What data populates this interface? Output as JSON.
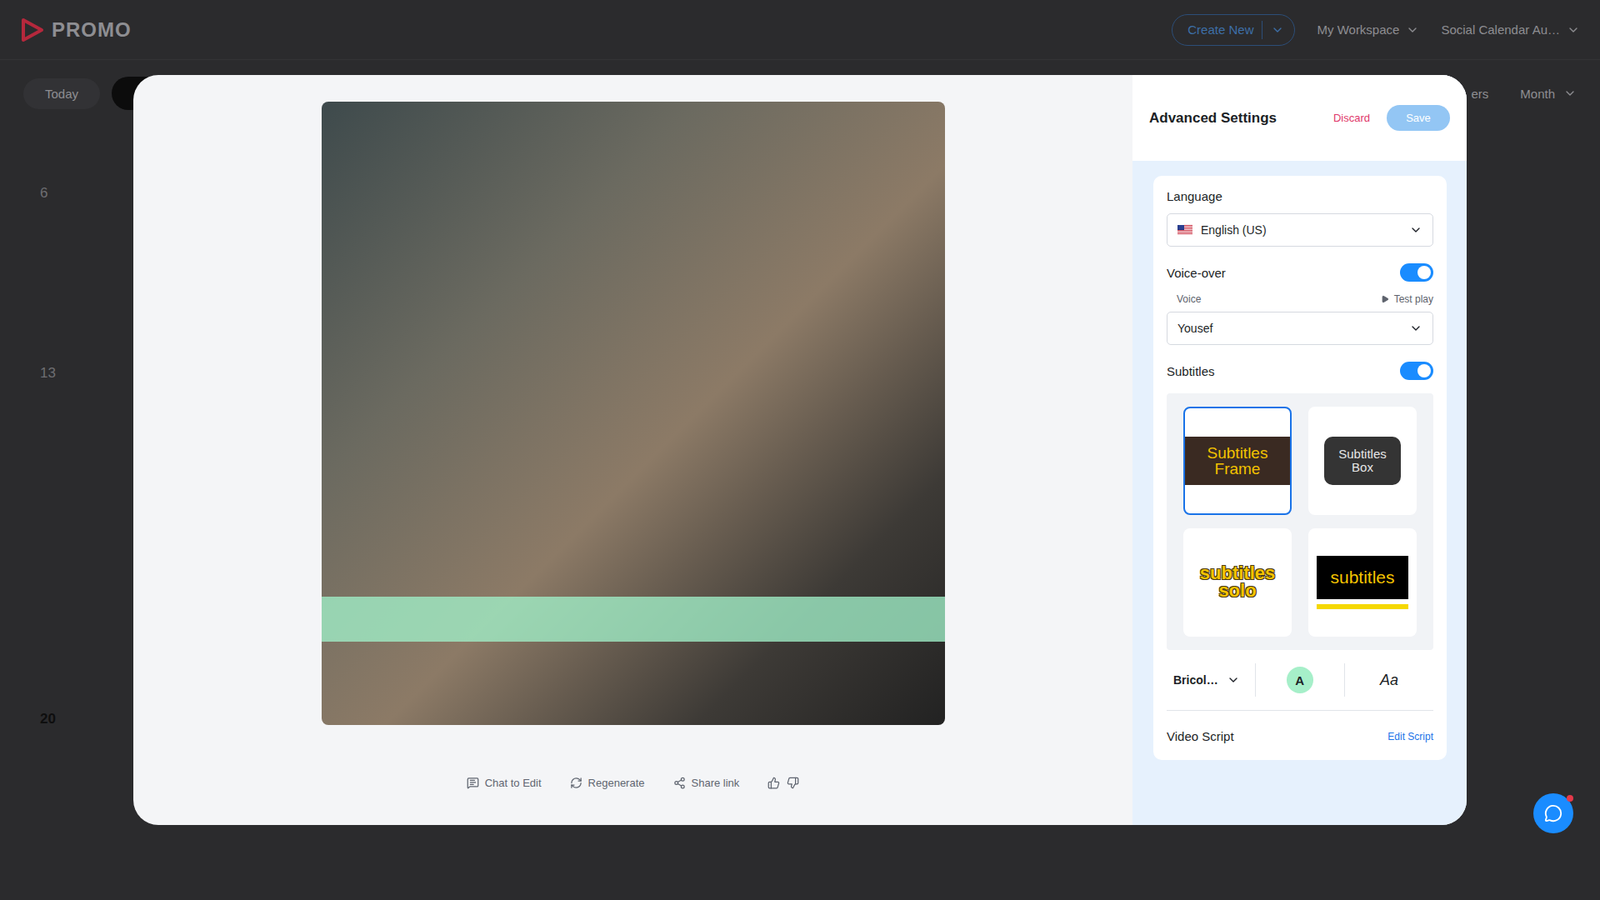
{
  "topbar": {
    "logo": "PROMO",
    "create_button": "Create New",
    "menus": [
      "My Workspace",
      "Social Calendar Au…"
    ]
  },
  "calendar_toolbar": {
    "today": "Today",
    "filters_partial": "ers",
    "view": "Month"
  },
  "calendar_days": [
    {
      "label": "6",
      "today": false
    },
    {
      "label": "13",
      "today": false
    },
    {
      "label": "20",
      "today": true
    }
  ],
  "preview": {
    "actions": [
      {
        "label": "Chat to Edit",
        "kind": "chat"
      },
      {
        "label": "Regenerate",
        "kind": "regenerate"
      },
      {
        "label": "Share link",
        "kind": "share"
      }
    ]
  },
  "settings": {
    "title": "Advanced Settings",
    "discard": "Discard",
    "save": {
      "label": "Save",
      "disabled": true
    },
    "language": {
      "label": "Language",
      "value": "English (US)"
    },
    "voiceover": {
      "label": "Voice-over",
      "on": true,
      "voice_label": "Voice",
      "test_play": "Test play",
      "voice": "Yousef"
    },
    "subtitles": {
      "label": "Subtitles",
      "on": true,
      "styles": [
        {
          "label": "Subtitles Frame",
          "kind": "frame",
          "selected": true
        },
        {
          "label": "Subtitles Box",
          "kind": "box",
          "selected": false
        },
        {
          "label": "subtitles solo",
          "kind": "solo",
          "selected": false
        },
        {
          "label": "subtitles",
          "kind": "bar",
          "selected": false
        }
      ],
      "font": "Bricol…",
      "color_swatch": {
        "label": "A",
        "color": "#a6efc9"
      },
      "case_label": "Aa"
    },
    "script": {
      "label": "Video Script",
      "edit": "Edit Script"
    }
  }
}
